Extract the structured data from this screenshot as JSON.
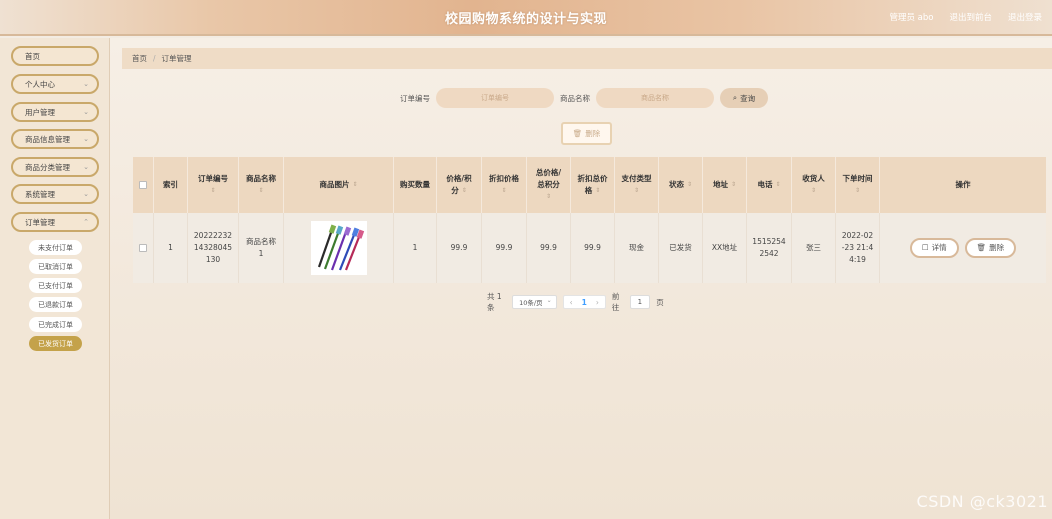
{
  "header": {
    "title": "校园购物系统的设计与实现",
    "user_label": "管理员 abo",
    "back_label": "退出到前台",
    "logout_label": "退出登录"
  },
  "sidebar": {
    "items": [
      {
        "label": "首页"
      },
      {
        "label": "个人中心"
      },
      {
        "label": "用户管理"
      },
      {
        "label": "商品信息管理"
      },
      {
        "label": "商品分类管理"
      },
      {
        "label": "系统管理"
      },
      {
        "label": "订单管理"
      }
    ],
    "sub_items": [
      {
        "label": "未支付订单"
      },
      {
        "label": "已取消订单"
      },
      {
        "label": "已支付订单"
      },
      {
        "label": "已退款订单"
      },
      {
        "label": "已完成订单"
      },
      {
        "label": "已发货订单"
      }
    ]
  },
  "breadcrumb": {
    "home": "首页",
    "current": "订单管理"
  },
  "search": {
    "order_label": "订单编号",
    "order_placeholder": "订单编号",
    "product_label": "商品名称",
    "product_placeholder": "商品名称",
    "query_label": "查询"
  },
  "toolbar": {
    "delete_label": "删除"
  },
  "table": {
    "headers": {
      "index": "索引",
      "order_no_1": "订单编号",
      "name_1": "商品名称",
      "image": "商品图片",
      "qty": "购买数量",
      "price_1": "价格/积",
      "price_2": "分",
      "discount": "折扣价格",
      "total_1": "总价格/",
      "total_2": "总积分",
      "discount_total_1": "折扣总价",
      "discount_total_2": "格",
      "pay_type": "支付类型",
      "status": "状态",
      "address": "地址",
      "phone": "电话",
      "receiver": "收货人",
      "order_time": "下单时间",
      "ops": "操作"
    },
    "rows": [
      {
        "index": "1",
        "order_no_1": "20222232",
        "order_no_2": "14328045",
        "order_no_3": "130",
        "name_1": "商品名称",
        "name_2": "1",
        "qty": "1",
        "price": "99.9",
        "discount": "99.9",
        "total": "99.9",
        "discount_total": "99.9",
        "pay_type": "现金",
        "status": "已发货",
        "address": "XX地址",
        "phone_1": "1515254",
        "phone_2": "2542",
        "receiver": "张三",
        "time_1": "2022-02",
        "time_2": "-23 21:4",
        "time_3": "4:19",
        "detail_label": "详情",
        "delete_label": "删除"
      }
    ]
  },
  "pagination": {
    "total": "共 1 条",
    "page_size": "10条/页",
    "current": "1",
    "goto_label": "前往",
    "goto_value": "1",
    "page_suffix": "页"
  },
  "watermark": "CSDN @ck3021",
  "colors": {
    "accent": "#c4a24a",
    "header": "#e2b48f",
    "table_head": "#edd8c0"
  }
}
